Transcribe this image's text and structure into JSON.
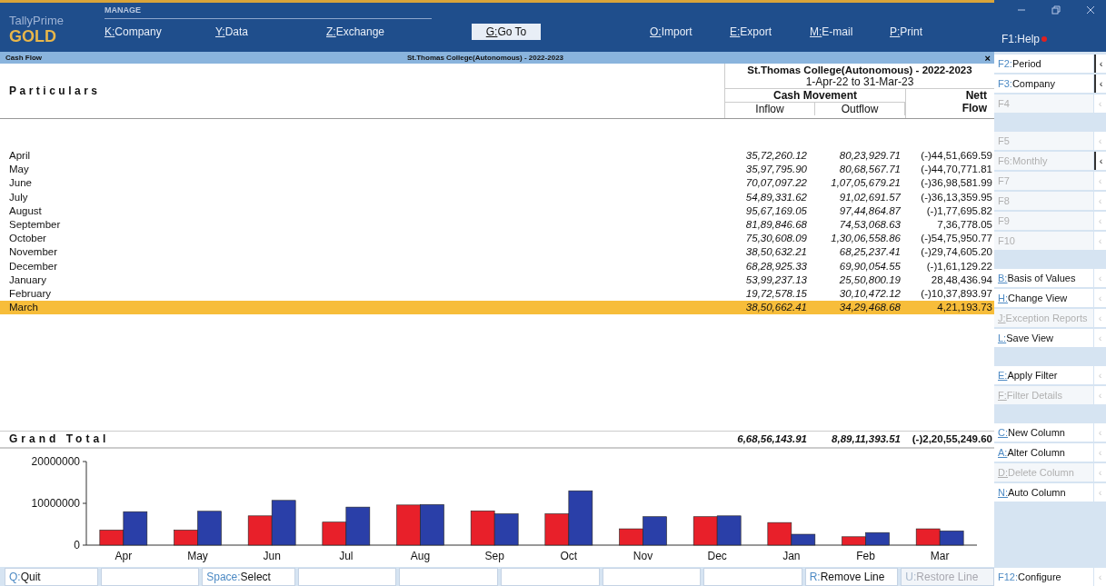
{
  "app": {
    "name": "TallyPrime",
    "edition": "GOLD",
    "section": "MANAGE"
  },
  "menu": [
    {
      "key": "K:",
      "label": "Company",
      "selected": false
    },
    {
      "key": "Y:",
      "label": "Data",
      "selected": false
    },
    {
      "key": "Z:",
      "label": "Exchange",
      "selected": false
    },
    {
      "key": "G:",
      "label": "Go To",
      "selected": true
    },
    {
      "key": "O:",
      "label": "Import",
      "selected": false
    },
    {
      "key": "E:",
      "label": "Export",
      "selected": false
    },
    {
      "key": "M:",
      "label": "E-mail",
      "selected": false
    },
    {
      "key": "P:",
      "label": "Print",
      "selected": false
    }
  ],
  "help": {
    "key": "F1:",
    "label": "Help"
  },
  "title_bar": {
    "title": "Cash Flow",
    "company": "St.Thomas College(Autonomous) - 2022-2023",
    "close": "×"
  },
  "report": {
    "particulars_heading": "Particulars",
    "company": "St.Thomas College(Autonomous) - 2022-2023",
    "period": "1-Apr-22 to 31-Mar-23",
    "group_heading": "Cash Movement",
    "columns": [
      "Inflow",
      "Outflow"
    ],
    "nett_heading": [
      "Nett",
      "Flow"
    ],
    "rows": [
      {
        "month": "April",
        "inflow": "35,72,260.12",
        "outflow": "80,23,929.71",
        "nett": "(-)44,51,669.59",
        "selected": false
      },
      {
        "month": "May",
        "inflow": "35,97,795.90",
        "outflow": "80,68,567.71",
        "nett": "(-)44,70,771.81",
        "selected": false
      },
      {
        "month": "June",
        "inflow": "70,07,097.22",
        "outflow": "1,07,05,679.21",
        "nett": "(-)36,98,581.99",
        "selected": false
      },
      {
        "month": "July",
        "inflow": "54,89,331.62",
        "outflow": "91,02,691.57",
        "nett": "(-)36,13,359.95",
        "selected": false
      },
      {
        "month": "August",
        "inflow": "95,67,169.05",
        "outflow": "97,44,864.87",
        "nett": "(-)1,77,695.82",
        "selected": false
      },
      {
        "month": "September",
        "inflow": "81,89,846.68",
        "outflow": "74,53,068.63",
        "nett": "7,36,778.05",
        "selected": false
      },
      {
        "month": "October",
        "inflow": "75,30,608.09",
        "outflow": "1,30,06,558.86",
        "nett": "(-)54,75,950.77",
        "selected": false
      },
      {
        "month": "November",
        "inflow": "38,50,632.21",
        "outflow": "68,25,237.41",
        "nett": "(-)29,74,605.20",
        "selected": false
      },
      {
        "month": "December",
        "inflow": "68,28,925.33",
        "outflow": "69,90,054.55",
        "nett": "(-)1,61,129.22",
        "selected": false
      },
      {
        "month": "January",
        "inflow": "53,99,237.13",
        "outflow": "25,50,800.19",
        "nett": "28,48,436.94",
        "selected": false
      },
      {
        "month": "February",
        "inflow": "19,72,578.15",
        "outflow": "30,10,472.12",
        "nett": "(-)10,37,893.97",
        "selected": false
      },
      {
        "month": "March",
        "inflow": "38,50,662.41",
        "outflow": "34,29,468.68",
        "nett": "4,21,193.73",
        "selected": true
      }
    ],
    "total": {
      "label": "Grand Total",
      "inflow": "6,68,56,143.91",
      "outflow": "8,89,11,393.51",
      "nett": "(-)2,20,55,249.60"
    },
    "chart_data": {
      "type": "bar",
      "categories": [
        "Apr",
        "May",
        "Jun",
        "Jul",
        "Aug",
        "Sep",
        "Oct",
        "Nov",
        "Dec",
        "Jan",
        "Feb",
        "Mar"
      ],
      "series": [
        {
          "color": "#e8202a",
          "values": [
            3600000,
            3600000,
            7000000,
            5500000,
            9600000,
            8200000,
            7500000,
            3900000,
            6800000,
            5400000,
            2000000,
            3900000
          ]
        },
        {
          "color": "#2a3fa8",
          "values": [
            8000000,
            8100000,
            10700000,
            9100000,
            9700000,
            7500000,
            13000000,
            6800000,
            7000000,
            2600000,
            3000000,
            3400000
          ]
        }
      ],
      "ylim": [
        0,
        20000000
      ],
      "yticks": [
        0,
        10000000,
        20000000
      ]
    }
  },
  "side_groups": [
    [
      {
        "key": "F2:",
        "label": "Period",
        "disabled": false,
        "underlined": false,
        "expandable": true,
        "caret": "‹"
      },
      {
        "key": "F3:",
        "label": "Company",
        "disabled": false,
        "underlined": false,
        "expandable": true,
        "caret": "‹"
      },
      {
        "key": "F4",
        "disabled": true,
        "underlined": false,
        "expandable": false,
        "caret": "‹"
      }
    ],
    [
      {
        "key": "F5",
        "disabled": true,
        "underlined": false,
        "expandable": false,
        "caret": "‹"
      },
      {
        "key": "F6:",
        "label": "Monthly",
        "disabled": true,
        "underlined": false,
        "expandable": true,
        "caret": "‹"
      },
      {
        "key": "F7",
        "disabled": true,
        "underlined": false,
        "expandable": false,
        "caret": "‹"
      },
      {
        "key": "F8",
        "disabled": true,
        "underlined": false,
        "expandable": false,
        "caret": "‹"
      },
      {
        "key": "F9",
        "disabled": true,
        "underlined": false,
        "expandable": false,
        "caret": "‹"
      },
      {
        "key": "F10",
        "disabled": true,
        "underlined": false,
        "expandable": false,
        "caret": "‹"
      }
    ],
    [
      {
        "key": "B:",
        "label": "Basis of Values",
        "disabled": false,
        "underlined": true,
        "expandable": false,
        "caret": "‹"
      },
      {
        "key": "H:",
        "label": "Change View",
        "disabled": false,
        "underlined": true,
        "expandable": false,
        "caret": "‹"
      },
      {
        "key": "J:",
        "label": "Exception Reports",
        "disabled": true,
        "underlined": true,
        "expandable": false,
        "caret": "‹"
      },
      {
        "key": "L:",
        "label": "Save View",
        "disabled": false,
        "underlined": true,
        "expandable": false,
        "caret": "‹"
      }
    ],
    [
      {
        "key": "E:",
        "label": "Apply Filter",
        "disabled": false,
        "underlined": true,
        "expandable": false,
        "caret": "‹"
      },
      {
        "key": "F:",
        "label": "Filter Details",
        "disabled": true,
        "underlined": true,
        "expandable": false,
        "caret": "‹"
      }
    ],
    [
      {
        "key": "C:",
        "label": "New Column",
        "disabled": false,
        "underlined": true,
        "expandable": false,
        "caret": "‹"
      },
      {
        "key": "A:",
        "label": "Alter Column",
        "disabled": false,
        "underlined": true,
        "expandable": false,
        "caret": "‹"
      },
      {
        "key": "D:",
        "label": "Delete Column",
        "disabled": true,
        "underlined": true,
        "expandable": false,
        "caret": "‹"
      },
      {
        "key": "N:",
        "label": "Auto Column",
        "disabled": false,
        "underlined": true,
        "expandable": false,
        "caret": "‹"
      }
    ]
  ],
  "configure": {
    "key": "F12:",
    "label": "Configure",
    "caret": "‹"
  },
  "bottom_bar": [
    {
      "kind": "action",
      "key": "Q:",
      "label": "Quit",
      "disabled": false
    },
    {
      "kind": "blank"
    },
    {
      "kind": "action",
      "key": "Space:",
      "label": "Select",
      "disabled": false
    },
    {
      "kind": "blank"
    },
    {
      "kind": "blank"
    },
    {
      "kind": "blank"
    },
    {
      "kind": "blank"
    },
    {
      "kind": "blank"
    },
    {
      "kind": "action",
      "key": "R:",
      "label": "Remove Line",
      "disabled": false
    },
    {
      "kind": "action",
      "key": "U:",
      "label": "Restore Line",
      "disabled": true
    }
  ]
}
